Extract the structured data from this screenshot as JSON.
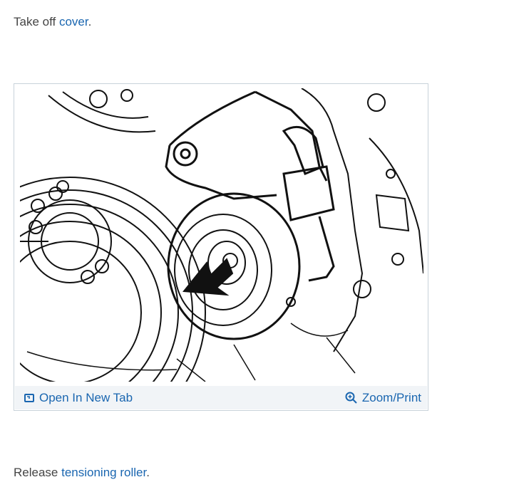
{
  "step1": {
    "prefix": "Take off ",
    "link": "cover",
    "suffix": "."
  },
  "figure": {
    "open_label": "Open In New Tab",
    "zoom_label": "Zoom/Print"
  },
  "step2": {
    "prefix": "Release ",
    "link": "tensioning roller",
    "suffix": "."
  },
  "colors": {
    "link": "#1a66b0",
    "text": "#444444",
    "figure_bar": "#f1f4f7",
    "figure_border": "#c8d2da"
  },
  "icons": {
    "open": "open-in-new-tab-icon",
    "zoom": "magnifier-plus-icon"
  }
}
